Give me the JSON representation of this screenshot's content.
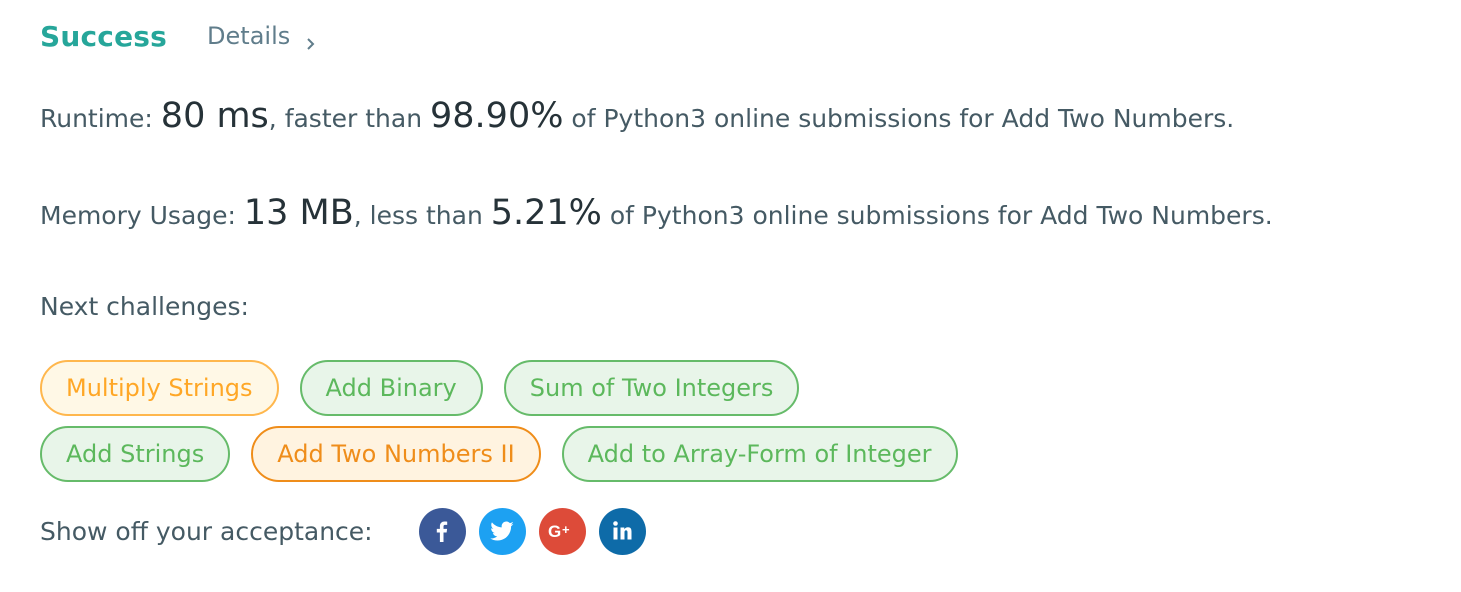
{
  "header": {
    "status": "Success",
    "details_label": "Details"
  },
  "runtime": {
    "label": "Runtime: ",
    "value": "80 ms",
    "mid": ", faster than ",
    "percent": "98.90%",
    "suffix": " of Python3 online submissions for Add Two Numbers."
  },
  "memory": {
    "label": "Memory Usage: ",
    "value": "13 MB",
    "mid": ", less than ",
    "percent": "5.21%",
    "suffix": " of Python3 online submissions for Add Two Numbers."
  },
  "next": {
    "label": "Next challenges:",
    "row1": [
      {
        "label": "Multiply Strings",
        "difficulty": "medium"
      },
      {
        "label": "Add Binary",
        "difficulty": "easy"
      },
      {
        "label": "Sum of Two Integers",
        "difficulty": "easy"
      }
    ],
    "row2": [
      {
        "label": "Add Strings",
        "difficulty": "easy"
      },
      {
        "label": "Add Two Numbers II",
        "difficulty": "medium"
      },
      {
        "label": "Add to Array-Form of Integer",
        "difficulty": "easy"
      }
    ]
  },
  "share": {
    "label": "Show off your acceptance:",
    "networks": [
      {
        "name": "facebook-icon",
        "color": "#3b5998"
      },
      {
        "name": "twitter-icon",
        "color": "#1da1f2"
      },
      {
        "name": "google-plus-icon",
        "color": "#dd4b39"
      },
      {
        "name": "linkedin-icon",
        "color": "#0e6ba8"
      }
    ]
  },
  "colors": {
    "success": "#26a69a",
    "easy": "#5cb85c",
    "medium": "#ffa726"
  }
}
